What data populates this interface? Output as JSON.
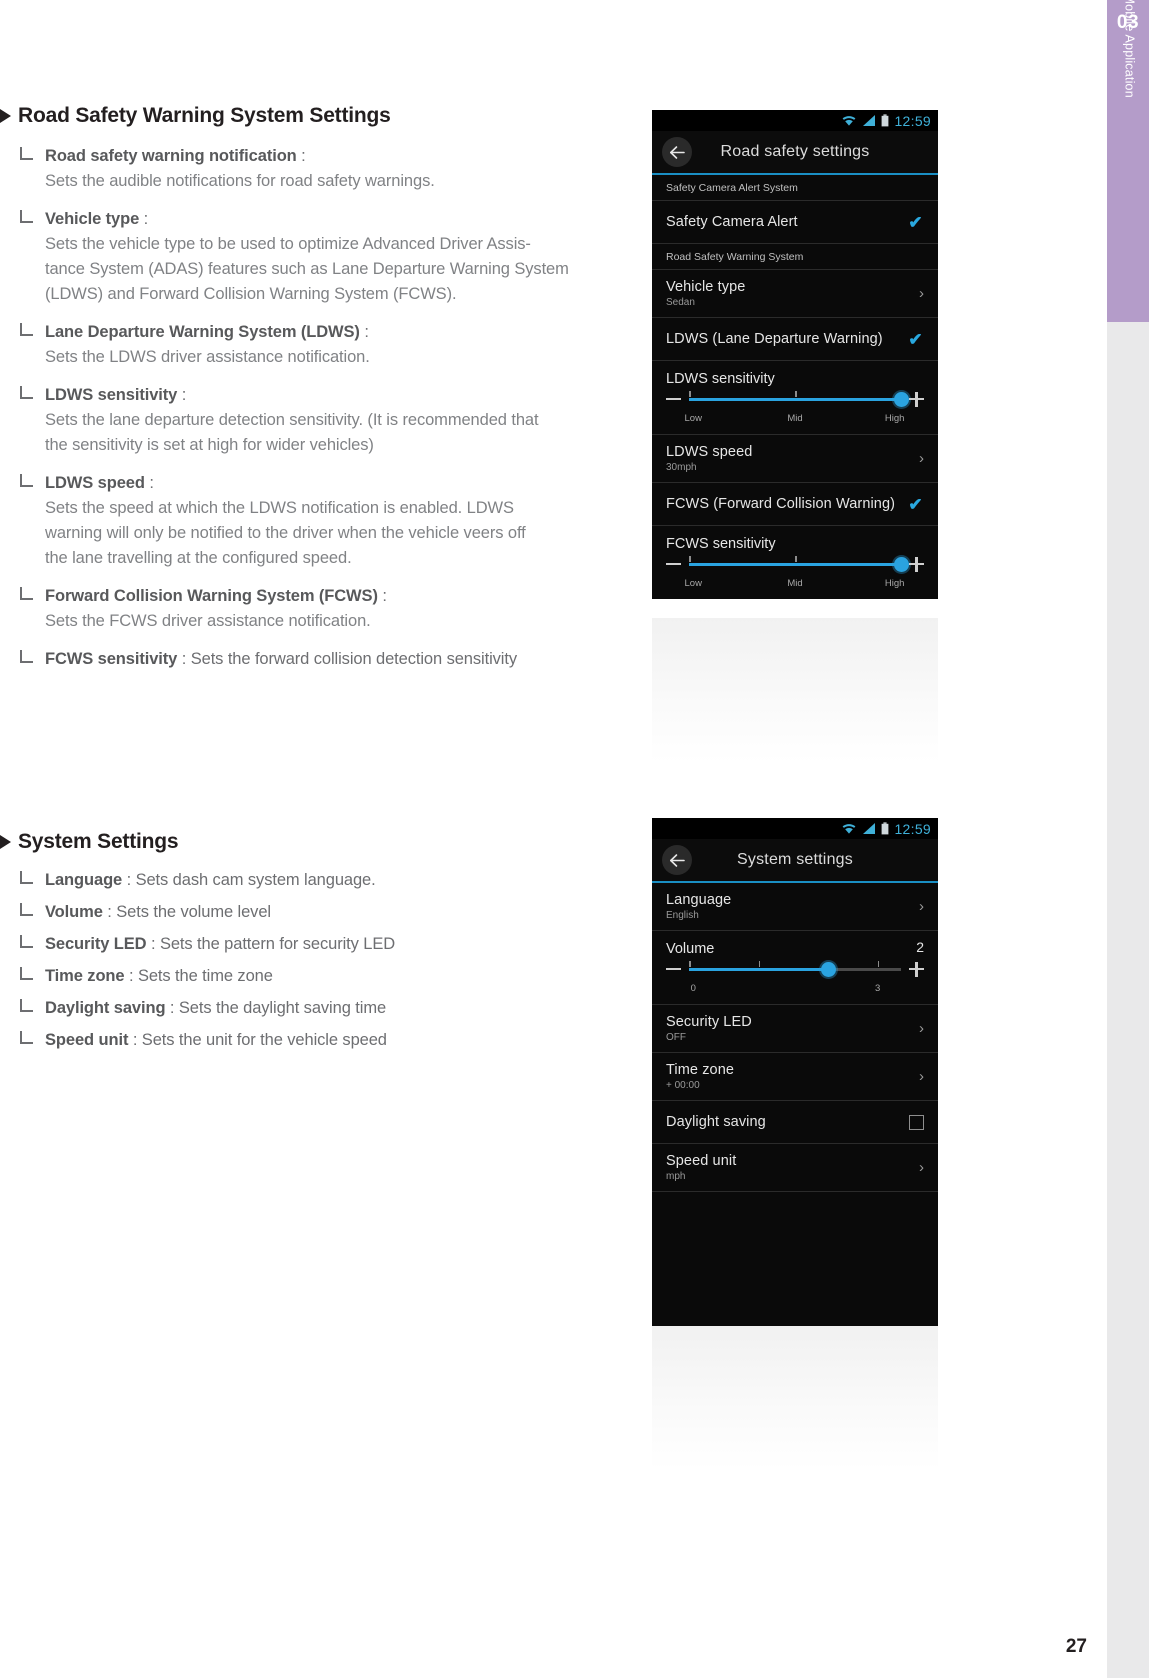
{
  "side_tab": {
    "chapter_number": "03",
    "chapter_label": "Mobile Application",
    "band_color": "#b49cc9"
  },
  "page_number": "27",
  "sections": [
    {
      "heading": "Road Safety Warning System Settings",
      "items": [
        {
          "term": "Road safety warning notification",
          "sep": " :",
          "inline": "",
          "desc": [
            "Sets the audible notifications for road safety warnings."
          ]
        },
        {
          "term": "Vehicle type",
          "sep": " :",
          "inline": "",
          "desc": [
            "Sets the vehicle type to be used to optimize Advanced Driver Assis-",
            "tance System (ADAS) features such as Lane Departure Warning System",
            "(LDWS) and Forward Collision Warning System (FCWS)."
          ]
        },
        {
          "term": "Lane Departure Warning System (LDWS)",
          "sep": " :",
          "inline": "",
          "desc": [
            "Sets the LDWS driver assistance notification."
          ]
        },
        {
          "term": "LDWS sensitivity",
          "sep": " :",
          "inline": "",
          "desc": [
            "Sets the lane departure detection sensitivity.  (It is recommended that",
            "the sensitivity is set at high for wider vehicles)"
          ]
        },
        {
          "term": "LDWS speed",
          "sep": " :",
          "inline": "",
          "desc": [
            "Sets the speed at which the LDWS notification is enabled.  LDWS",
            "warning will only be notified to the driver when the vehicle veers off",
            "the lane travelling at the configured speed."
          ]
        },
        {
          "term": "Forward Collision Warning System (FCWS)",
          "sep": " :",
          "inline": "",
          "desc": [
            "Sets the FCWS driver assistance notification."
          ]
        },
        {
          "term": "FCWS sensitivity",
          "sep": " : ",
          "inline": "Sets the forward collision detection sensitivity",
          "desc": []
        }
      ]
    },
    {
      "heading": "System Settings",
      "items": [
        {
          "term": "Language",
          "sep": " : ",
          "inline": "Sets dash cam system language.",
          "desc": []
        },
        {
          "term": "Volume",
          "sep": " : ",
          "inline": "Sets the volume level",
          "desc": []
        },
        {
          "term": "Security LED",
          "sep": " : ",
          "inline": "Sets the pattern for security LED",
          "desc": []
        },
        {
          "term": "Time zone",
          "sep": " : ",
          "inline": "Sets the time zone",
          "desc": []
        },
        {
          "term": "Daylight saving",
          "sep": " : ",
          "inline": "Sets the daylight saving time",
          "desc": []
        },
        {
          "term": "Speed unit",
          "sep": " : ",
          "inline": "Sets the unit for the vehicle speed",
          "desc": []
        }
      ]
    }
  ],
  "phone1": {
    "status": {
      "time": "12:59",
      "wifi_icon": "wifi-icon",
      "signal_icon": "signal-icon",
      "battery_icon": "battery-icon"
    },
    "appbar": {
      "back_icon": "back-arrow-icon",
      "title": "Road safety settings"
    },
    "group1_header": "Safety Camera Alert System",
    "row_safety_camera_alert": {
      "title": "Safety Camera Alert",
      "checked": true,
      "check_glyph": "✔"
    },
    "group2_header": "Road Safety Warning System",
    "row_vehicle_type": {
      "title": "Vehicle type",
      "value": "Sedan",
      "chevron": "›"
    },
    "row_ldws": {
      "title": "LDWS (Lane Departure Warning)",
      "checked": true,
      "check_glyph": "✔"
    },
    "ldws_sensitivity": {
      "label": "LDWS sensitivity",
      "minus": "minus-icon",
      "plus": "plus-icon",
      "scale": [
        "Low",
        "Mid",
        "High"
      ],
      "value_percent": 100
    },
    "row_ldws_speed": {
      "title": "LDWS speed",
      "value": "30mph",
      "chevron": "›"
    },
    "row_fcws": {
      "title": "FCWS  (Forward Collision Warning)",
      "checked": true,
      "check_glyph": "✔"
    },
    "fcws_sensitivity": {
      "label": "FCWS sensitivity",
      "minus": "minus-icon",
      "plus": "plus-icon",
      "scale": [
        "Low",
        "Mid",
        "High"
      ],
      "value_percent": 100
    }
  },
  "phone2": {
    "status": {
      "time": "12:59",
      "wifi_icon": "wifi-icon",
      "signal_icon": "signal-icon",
      "battery_icon": "battery-icon"
    },
    "appbar": {
      "back_icon": "back-arrow-icon",
      "title": "System settings"
    },
    "row_language": {
      "title": "Language",
      "value": "English",
      "chevron": "›"
    },
    "volume": {
      "label": "Volume",
      "value": "2",
      "minus": "minus-icon",
      "plus": "plus-icon",
      "scale": [
        "0",
        "3"
      ],
      "value_percent": 66
    },
    "row_security_led": {
      "title": "Security LED",
      "value": "OFF",
      "chevron": "›"
    },
    "row_time_zone": {
      "title": "Time zone",
      "value": "+ 00:00",
      "chevron": "›"
    },
    "row_daylight_saving": {
      "title": "Daylight saving",
      "checked": false
    },
    "row_speed_unit": {
      "title": "Speed unit",
      "value": "mph",
      "chevron": "›"
    }
  },
  "colors": {
    "accent_blue": "#2aa3e0",
    "appbar_underline": "#1a8fc4",
    "tab_purple": "#b49cc9",
    "text_dark": "#231f20",
    "text_grey": "#808285"
  }
}
